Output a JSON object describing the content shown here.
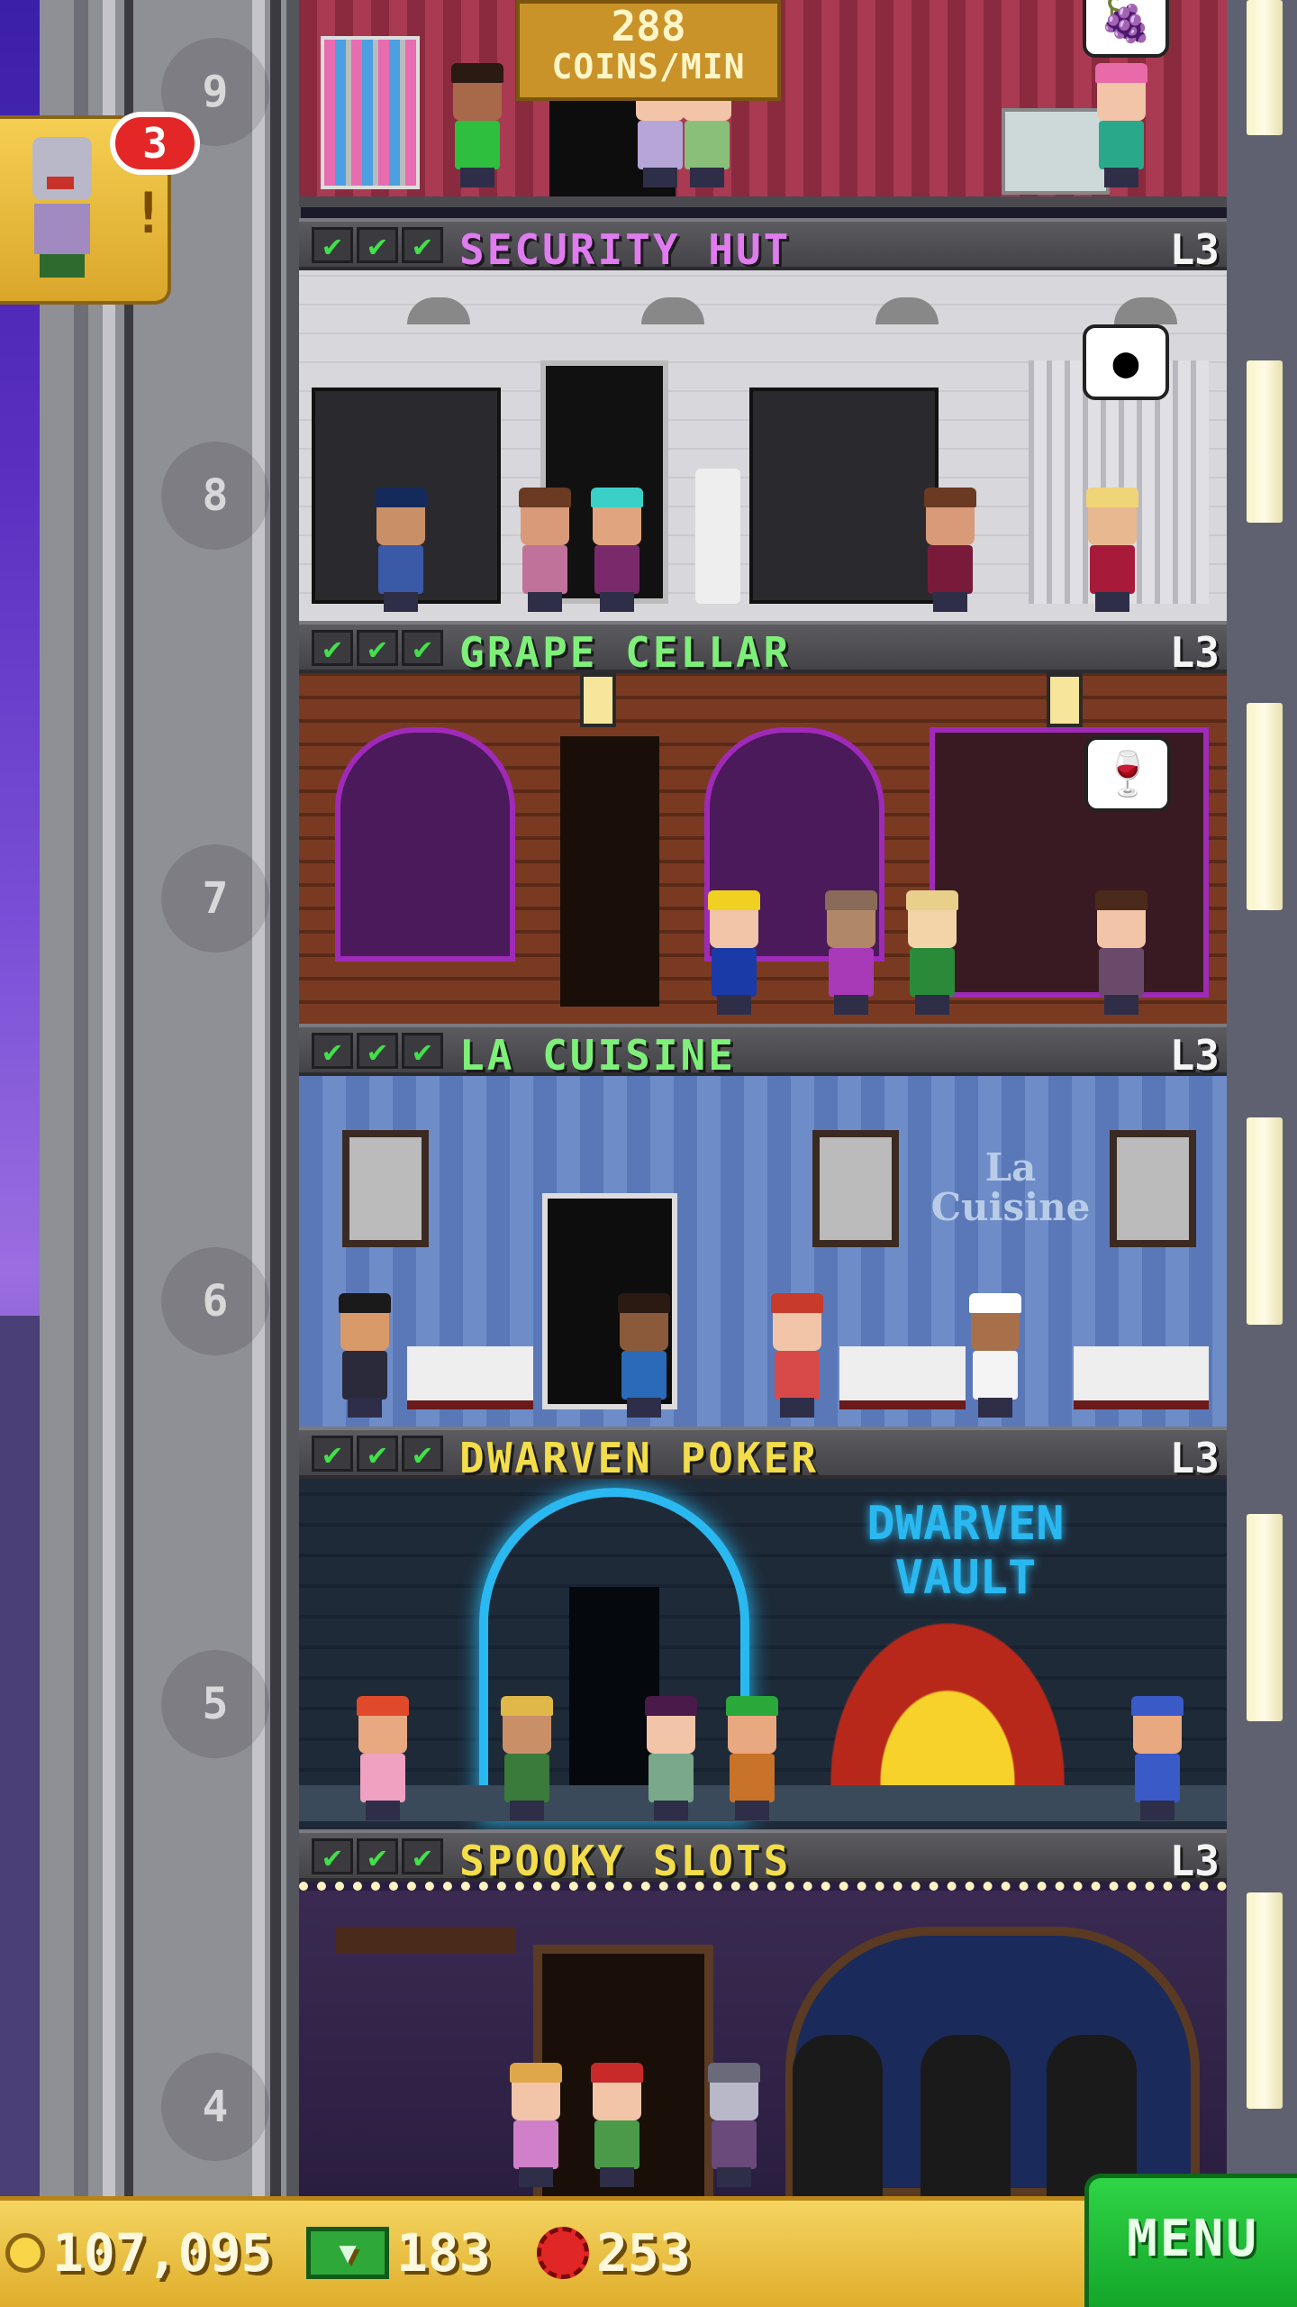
{
  "hud": {
    "coins": "107,095",
    "tower_bux": "183",
    "gems": "253",
    "menu_label": "MENU"
  },
  "earnings_sign": {
    "value": "288",
    "unit": "COINS/MIN"
  },
  "notification": {
    "badge_count": "3",
    "marker": "!"
  },
  "floors": [
    {
      "number": "9"
    },
    {
      "number": "8",
      "name": "SECURITY HUT",
      "level": "L3",
      "checks": [
        "✔",
        "✔",
        "✔"
      ],
      "name_color": "#e07bf0"
    },
    {
      "number": "7",
      "name": "GRAPE CELLAR",
      "level": "L3",
      "checks": [
        "✔",
        "✔",
        "✔"
      ],
      "name_color": "#7ef07a"
    },
    {
      "number": "6",
      "name": "LA CUISINE",
      "level": "L3",
      "checks": [
        "✔",
        "✔",
        "✔"
      ],
      "name_color": "#7ef07a"
    },
    {
      "number": "5",
      "name": "DWARVEN POKER",
      "level": "L3",
      "checks": [
        "✔",
        "✔",
        "✔"
      ],
      "name_color": "#f3dd4a"
    },
    {
      "number": "4",
      "name": "SPOOKY SLOTS",
      "level": "L3",
      "checks": [
        "✔",
        "✔",
        "✔"
      ],
      "name_color": "#f3dd4a"
    }
  ],
  "signs": {
    "la_cuisine_wall": "La Cuisine",
    "dwarven_vault": "DWARVEN VAULT"
  },
  "icons": {
    "coin": "coin-icon",
    "bux": "tower-bux-icon",
    "gem": "gem-icon",
    "check": "check-icon"
  }
}
